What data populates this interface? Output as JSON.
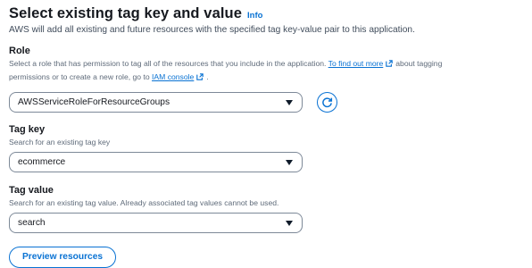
{
  "header": {
    "title": "Select existing tag key and value",
    "info_label": "Info",
    "subtitle": "AWS will add all existing and future resources with the specified tag key-value pair to this application."
  },
  "role": {
    "label": "Role",
    "description_part1": "Select a role that has permission to tag all of the resources that you include in the application.",
    "find_out_more_link": "To find out more",
    "description_part2": "about tagging",
    "description_part3": "permissions or to create a new role, go to",
    "iam_console_link": "IAM console",
    "description_part4": ".",
    "selected_value": "AWSServiceRoleForResourceGroups"
  },
  "tag_key": {
    "label": "Tag key",
    "description": "Search for an existing tag key",
    "selected_value": "ecommerce"
  },
  "tag_value": {
    "label": "Tag value",
    "description": "Search for an existing tag value. Already associated tag values cannot be used.",
    "selected_value": "search"
  },
  "actions": {
    "preview_label": "Preview resources"
  },
  "icons": {
    "external_link": "external-link-icon",
    "refresh": "refresh-icon",
    "dropdown": "caret-down-icon"
  },
  "colors": {
    "link": "#0972d3",
    "text": "#16191f",
    "muted": "#5f6b7a",
    "border": "#7d8998"
  }
}
